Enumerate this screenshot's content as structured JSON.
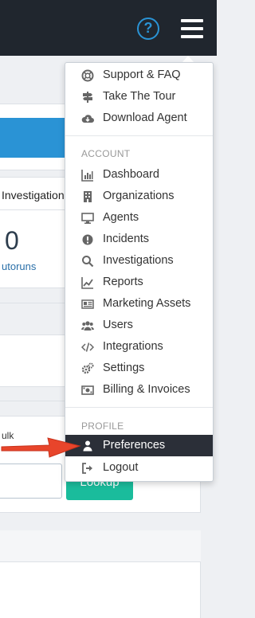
{
  "topbar": {
    "help_icon": "question-circle-icon",
    "help_glyph": "?",
    "menu_icon": "hamburger-menu-icon"
  },
  "background": {
    "tab_label": "Investigation",
    "stat_value": "0",
    "stat_caption": "utoruns",
    "bulk_label": "ulk",
    "lookup_label": "Lookup"
  },
  "menu": {
    "top_items": [
      {
        "label": "Support & FAQ",
        "icon": "lifebuoy-icon"
      },
      {
        "label": "Take The Tour",
        "icon": "signpost-icon"
      },
      {
        "label": "Download Agent",
        "icon": "cloud-download-icon"
      }
    ],
    "account_label": "ACCOUNT",
    "account_items": [
      {
        "label": "Dashboard",
        "icon": "bar-chart-icon"
      },
      {
        "label": "Organizations",
        "icon": "building-icon"
      },
      {
        "label": "Agents",
        "icon": "desktop-icon"
      },
      {
        "label": "Incidents",
        "icon": "exclamation-circle-icon"
      },
      {
        "label": "Investigations",
        "icon": "search-icon"
      },
      {
        "label": "Reports",
        "icon": "line-chart-icon"
      },
      {
        "label": "Marketing Assets",
        "icon": "newspaper-icon"
      },
      {
        "label": "Users",
        "icon": "users-icon"
      },
      {
        "label": "Integrations",
        "icon": "code-icon"
      },
      {
        "label": "Settings",
        "icon": "gears-icon"
      },
      {
        "label": "Billing & Invoices",
        "icon": "money-bill-icon"
      }
    ],
    "profile_label": "PROFILE",
    "profile_items": [
      {
        "label": "Preferences",
        "icon": "user-icon",
        "active": true
      },
      {
        "label": "Logout",
        "icon": "sign-out-icon"
      }
    ]
  },
  "annotation": {
    "arrow_color": "#e8452b"
  },
  "colors": {
    "topbar": "#20262e",
    "accent_blue": "#2a93d5",
    "lookup_green": "#1abc9c",
    "active_item": "#2b2f38"
  }
}
